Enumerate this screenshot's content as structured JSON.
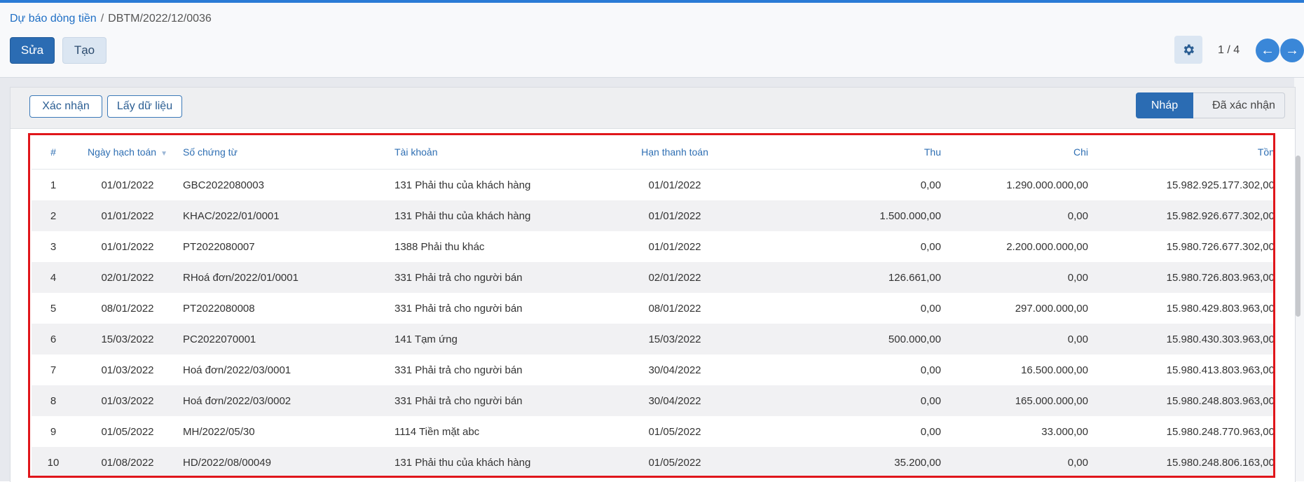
{
  "breadcrumb": {
    "parent": "Dự báo dòng tiền",
    "separator": "/",
    "current": "DBTM/2022/12/0036"
  },
  "toolbar": {
    "edit_label": "Sửa",
    "create_label": "Tạo"
  },
  "pager": {
    "text": "1 / 4"
  },
  "actions": {
    "confirm_label": "Xác nhận",
    "fetch_label": "Lấy dữ liệu"
  },
  "stages": {
    "draft": "Nháp",
    "confirmed": "Đã xác nhận"
  },
  "table": {
    "headers": {
      "num": "#",
      "date": "Ngày hạch toán",
      "doc": "Số chứng từ",
      "account": "Tài khoản",
      "due": "Hạn thanh toán",
      "thu": "Thu",
      "chi": "Chi",
      "ton": "Tồn"
    },
    "rows": [
      {
        "num": "1",
        "date": "01/01/2022",
        "doc": "GBC2022080003",
        "account": "131 Phải thu của khách hàng",
        "due": "01/01/2022",
        "thu": "0,00",
        "chi": "1.290.000.000,00",
        "ton": "15.982.925.177.302,00"
      },
      {
        "num": "2",
        "date": "01/01/2022",
        "doc": "KHAC/2022/01/0001",
        "account": "131 Phải thu của khách hàng",
        "due": "01/01/2022",
        "thu": "1.500.000,00",
        "chi": "0,00",
        "ton": "15.982.926.677.302,00"
      },
      {
        "num": "3",
        "date": "01/01/2022",
        "doc": "PT2022080007",
        "account": "1388 Phải thu khác",
        "due": "01/01/2022",
        "thu": "0,00",
        "chi": "2.200.000.000,00",
        "ton": "15.980.726.677.302,00"
      },
      {
        "num": "4",
        "date": "02/01/2022",
        "doc": "RHoá đơn/2022/01/0001",
        "account": "331 Phải trả cho người bán",
        "due": "02/01/2022",
        "thu": "126.661,00",
        "chi": "0,00",
        "ton": "15.980.726.803.963,00"
      },
      {
        "num": "5",
        "date": "08/01/2022",
        "doc": "PT2022080008",
        "account": "331 Phải trả cho người bán",
        "due": "08/01/2022",
        "thu": "0,00",
        "chi": "297.000.000,00",
        "ton": "15.980.429.803.963,00"
      },
      {
        "num": "6",
        "date": "15/03/2022",
        "doc": "PC2022070001",
        "account": "141 Tạm ứng",
        "due": "15/03/2022",
        "thu": "500.000,00",
        "chi": "0,00",
        "ton": "15.980.430.303.963,00"
      },
      {
        "num": "7",
        "date": "01/03/2022",
        "doc": "Hoá đơn/2022/03/0001",
        "account": "331 Phải trả cho người bán",
        "due": "30/04/2022",
        "thu": "0,00",
        "chi": "16.500.000,00",
        "ton": "15.980.413.803.963,00"
      },
      {
        "num": "8",
        "date": "01/03/2022",
        "doc": "Hoá đơn/2022/03/0002",
        "account": "331 Phải trả cho người bán",
        "due": "30/04/2022",
        "thu": "0,00",
        "chi": "165.000.000,00",
        "ton": "15.980.248.803.963,00"
      },
      {
        "num": "9",
        "date": "01/05/2022",
        "doc": "MH/2022/05/30",
        "account": "1114 Tiền mặt abc",
        "due": "01/05/2022",
        "thu": "0,00",
        "chi": "33.000,00",
        "ton": "15.980.248.770.963,00"
      },
      {
        "num": "10",
        "date": "01/08/2022",
        "doc": "HD/2022/08/00049",
        "account": "131 Phải thu của khách hàng",
        "due": "01/05/2022",
        "thu": "35.200,00",
        "chi": "0,00",
        "ton": "15.980.248.806.163,00"
      }
    ]
  },
  "icons": {
    "settings": "gear-icon",
    "prev": "arrow-left-icon",
    "next": "arrow-right-icon",
    "sort": "sort-down-icon"
  },
  "colors": {
    "primary": "#2b6cb3",
    "highlight_border": "#e0161b",
    "header_text": "#2f6fb3"
  }
}
